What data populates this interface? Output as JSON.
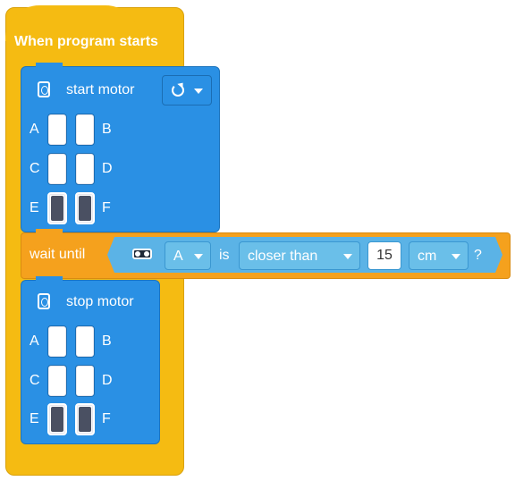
{
  "hat": {
    "title": "When program starts"
  },
  "start_motor": {
    "label": "start motor",
    "direction_icon": "rotate-clockwise-icon",
    "ports": [
      {
        "left": "A",
        "right": "B",
        "left_active": false,
        "right_active": false
      },
      {
        "left": "C",
        "right": "D",
        "left_active": false,
        "right_active": false
      },
      {
        "left": "E",
        "right": "F",
        "left_active": true,
        "right_active": true
      }
    ]
  },
  "wait_until": {
    "label": "wait until",
    "sensor_icon": "distance-sensor-icon",
    "port": "A",
    "is_label": "is",
    "comparison": "closer than",
    "value": "15",
    "unit": "cm",
    "question": "?"
  },
  "stop_motor": {
    "label": "stop motor",
    "ports": [
      {
        "left": "A",
        "right": "B",
        "left_active": false,
        "right_active": false
      },
      {
        "left": "C",
        "right": "D",
        "left_active": false,
        "right_active": false
      },
      {
        "left": "E",
        "right": "F",
        "left_active": true,
        "right_active": true
      }
    ]
  },
  "colors": {
    "event_yellow": "#f5bb12",
    "control_orange": "#f5a11d",
    "motor_blue": "#2a90e4",
    "sensor_light_blue": "#5bb3e6"
  }
}
